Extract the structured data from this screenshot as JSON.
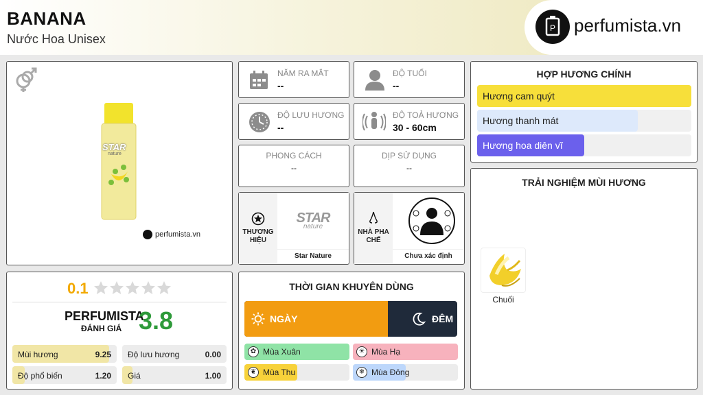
{
  "header": {
    "title": "BANANA",
    "subtitle": "Nước Hoa Unisex",
    "logo_text": "perfumista.vn"
  },
  "product": {
    "gender_icon": "unisex-gender-icon",
    "bottle_brand": "STAR",
    "bottle_sub": "nature",
    "watermark": "perfumista.vn"
  },
  "info": {
    "release_year": {
      "label": "NĂM RA MẮT",
      "value": "--",
      "icon": "calendar-icon"
    },
    "age": {
      "label": "ĐỘ TUỔI",
      "value": "--",
      "icon": "user-icon"
    },
    "longevity": {
      "label": "ĐỘ LƯU HƯƠNG",
      "value": "--",
      "icon": "clock-icon"
    },
    "sillage": {
      "label": "ĐỘ TOẢ HƯƠNG",
      "value": "30 - 60cm",
      "icon": "sillage-icon"
    },
    "style": {
      "label": "PHONG CÁCH",
      "value": "--"
    },
    "occasion": {
      "label": "DỊP SỬ DỤNG",
      "value": "--"
    }
  },
  "brand": {
    "label_line1": "THƯƠNG",
    "label_line2": "HIỆU",
    "logo_top": "STAR",
    "logo_bottom": "nature",
    "name": "Star Nature"
  },
  "perfumer": {
    "label_line1": "NHÀ PHA",
    "label_line2": "CHẾ",
    "name": "Chưa xác định"
  },
  "accords": {
    "title": "HỢP HƯƠNG CHÍNH",
    "items": [
      {
        "label": "Hương cam quýt",
        "percent": 100,
        "color": "#f7df3a"
      },
      {
        "label": "Hương thanh mát",
        "percent": 75,
        "color": "#dde9fb"
      },
      {
        "label": "Hương hoa diên vĩ",
        "percent": 50,
        "color": "#6b60ec"
      }
    ]
  },
  "notes": {
    "title": "TRẢI NGHIỆM MÙI HƯƠNG",
    "items": [
      {
        "label": "Chuối"
      }
    ]
  },
  "rating": {
    "user_score": "0.1",
    "stars": 5,
    "stars_filled": 0,
    "brand_label": "PERFUMISTA",
    "brand_sub": "ĐÁNH GIÁ",
    "score": "3.8",
    "rows": [
      {
        "label": "Mùi hương",
        "value": "9.25",
        "fill": 0.93
      },
      {
        "label": "Độ lưu hương",
        "value": "0.00",
        "fill": 0
      },
      {
        "label": "Độ phổ biến",
        "value": "1.20",
        "fill": 0.12
      },
      {
        "label": "Giá",
        "value": "1.00",
        "fill": 0.1
      }
    ]
  },
  "timing": {
    "title": "THỜI GIAN KHUYÊN DÙNG",
    "day_label": "NGÀY",
    "night_label": "ĐÊM",
    "day_percent": 100,
    "night_percent": 0,
    "seasons": [
      {
        "label": "Mùa Xuân",
        "icon": "flower-icon",
        "fill": 1.0,
        "color": "#8fe3a6"
      },
      {
        "label": "Mùa Hạ",
        "icon": "sun-icon",
        "fill": 1.0,
        "color": "#f7b2bd"
      },
      {
        "label": "Mùa Thu",
        "icon": "leaf-icon",
        "fill": 0.5,
        "color": "#f7d23a"
      },
      {
        "label": "Mùa Đông",
        "icon": "snowflake-icon",
        "fill": 0.5,
        "color": "#bdd7fb"
      }
    ]
  }
}
